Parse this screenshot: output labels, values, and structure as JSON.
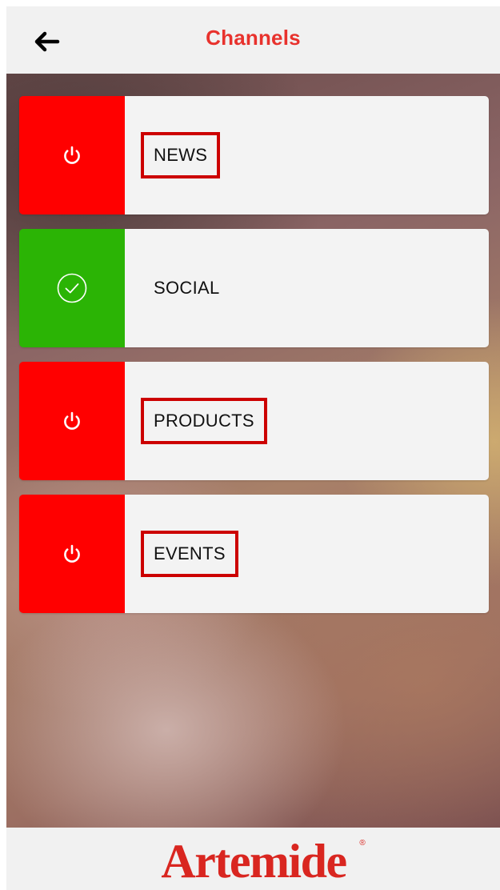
{
  "header": {
    "title": "Channels",
    "back_icon": "arrow-left-icon"
  },
  "channels": [
    {
      "label": "NEWS",
      "status": "off",
      "icon": "power-icon",
      "status_color": "#ff0000"
    },
    {
      "label": "SOCIAL",
      "status": "on",
      "icon": "check-circle-icon",
      "status_color": "#2bb405"
    },
    {
      "label": "PRODUCTS",
      "status": "off",
      "icon": "power-icon",
      "status_color": "#ff0000"
    },
    {
      "label": "EVENTS",
      "status": "off",
      "icon": "power-icon",
      "status_color": "#ff0000"
    }
  ],
  "footer": {
    "logo_text": "Artemide",
    "logo_mark": "®"
  },
  "colors": {
    "accent": "#e8322d",
    "brand": "#d92620",
    "header_bg": "#f1f1f1",
    "card_bg": "#f3f3f3",
    "highlight_border": "#cc0000"
  }
}
